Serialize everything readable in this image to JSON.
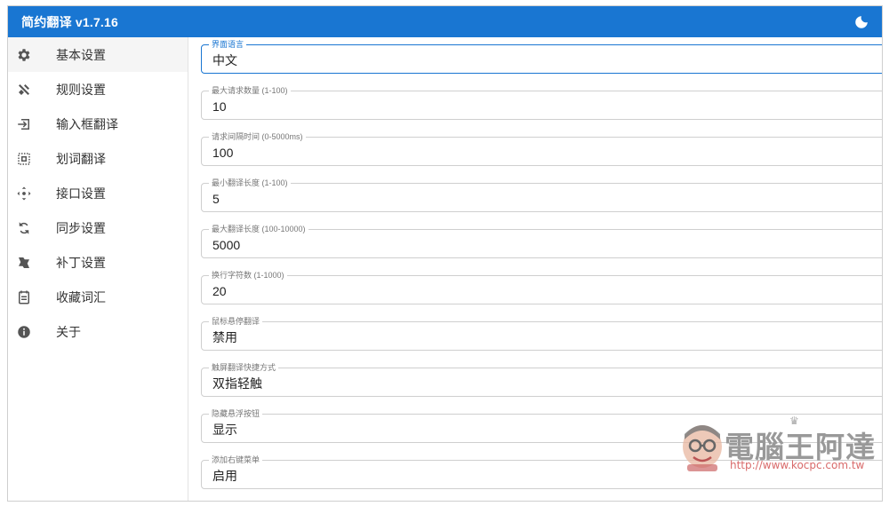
{
  "app": {
    "title": "简约翻译 v1.7.16",
    "theme_icon": "moon-icon"
  },
  "sidebar": {
    "items": [
      {
        "label": "基本设置",
        "icon": "gear-icon",
        "active": true
      },
      {
        "label": "规则设置",
        "icon": "tools-icon",
        "active": false
      },
      {
        "label": "输入框翻译",
        "icon": "input-icon",
        "active": false
      },
      {
        "label": "划词翻译",
        "icon": "select-icon",
        "active": false
      },
      {
        "label": "接口设置",
        "icon": "api-icon",
        "active": false
      },
      {
        "label": "同步设置",
        "icon": "sync-icon",
        "active": false
      },
      {
        "label": "补丁设置",
        "icon": "patch-icon",
        "active": false
      },
      {
        "label": "收藏词汇",
        "icon": "bookmark-icon",
        "active": false
      },
      {
        "label": "关于",
        "icon": "info-icon",
        "active": false
      }
    ]
  },
  "settings": [
    {
      "label": "界面语言",
      "value": "中文",
      "control": "select"
    },
    {
      "label": "最大请求数量 (1-100)",
      "value": "10",
      "control": "number"
    },
    {
      "label": "请求间隔时间 (0-5000ms)",
      "value": "100",
      "control": "text"
    },
    {
      "label": "最小翻译长度 (1-100)",
      "value": "5",
      "control": "text"
    },
    {
      "label": "最大翻译长度 (100-10000)",
      "value": "5000",
      "control": "text"
    },
    {
      "label": "换行字符数 (1-1000)",
      "value": "20",
      "control": "text"
    },
    {
      "label": "鼠标悬停翻译",
      "value": "禁用",
      "control": "select"
    },
    {
      "label": "触屏翻译快捷方式",
      "value": "双指轻触",
      "control": "select"
    },
    {
      "label": "隐藏悬浮按钮",
      "value": "显示",
      "control": "select"
    },
    {
      "label": "添加右键菜单",
      "value": "启用",
      "control": "select"
    }
  ],
  "watermark": {
    "name": "電腦王阿達",
    "url": "http://www.kocpc.com.tw"
  },
  "colors": {
    "primary": "#1976d2",
    "border": "#cfcfcf",
    "active_bg": "#f5f5f5"
  }
}
